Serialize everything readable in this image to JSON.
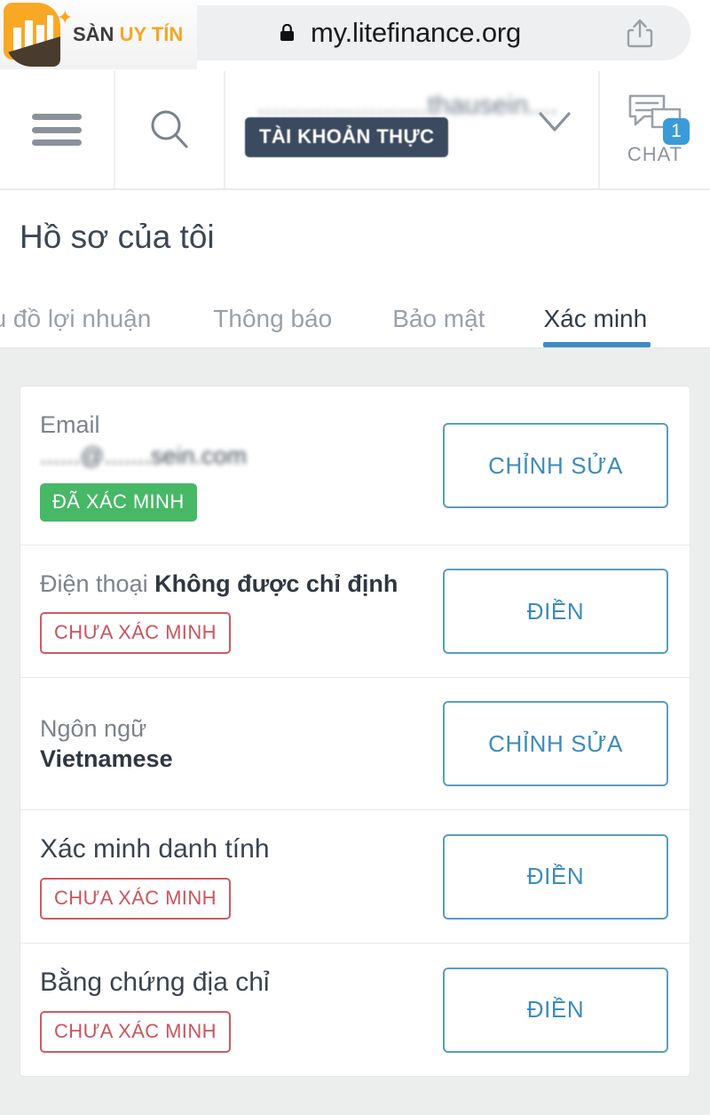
{
  "browser": {
    "url": "my.litefinance.org",
    "lock_icon": "lock-icon",
    "share_icon": "share-icon"
  },
  "watermark": {
    "text_primary": "SÀN",
    "text_accent": "UY TÍN"
  },
  "topnav": {
    "menu_icon": "hamburger-menu-icon",
    "search_icon": "search-icon",
    "account_name": ".......................thausein....",
    "account_badge": "TÀI KHOẢN THỰC",
    "dropdown_icon": "chevron-down-icon",
    "chat_label": "CHAT",
    "chat_count": "1",
    "chat_icon": "chat-bubbles-icon"
  },
  "page": {
    "title": "Hồ sơ của tôi"
  },
  "tabs": [
    {
      "label": "ểu đồ lợi nhuận",
      "active": false
    },
    {
      "label": "Thông báo",
      "active": false
    },
    {
      "label": "Bảo mật",
      "active": false
    },
    {
      "label": "Xác minh",
      "active": true
    }
  ],
  "rows": [
    {
      "label": "Email",
      "value": "......@.......sein.com",
      "badge": "ĐÃ XÁC MINH",
      "badge_state": "verified",
      "action": "CHỈNH SỬA"
    },
    {
      "label": "Điện thoại",
      "value": "Không được chỉ định",
      "badge": "CHƯA XÁC MINH",
      "badge_state": "unverified",
      "action": "ĐIỀN"
    },
    {
      "label": "Ngôn ngữ",
      "value": "Vietnamese",
      "badge": "",
      "badge_state": "none",
      "action": "CHỈNH SỬA"
    },
    {
      "label": "Xác minh danh tính",
      "value": "",
      "badge": "CHƯA XÁC MINH",
      "badge_state": "unverified",
      "action": "ĐIỀN"
    },
    {
      "label": "Bằng chứng địa chỉ",
      "value": "",
      "badge": "CHƯA XÁC MINH",
      "badge_state": "unverified",
      "action": "ĐIỀN"
    }
  ],
  "colors": {
    "accent_blue": "#3d8bbf",
    "verified_green": "#46b866",
    "unverified_red": "#c9555f",
    "badge_navy": "#3b4a5e",
    "logo_orange": "#f5a623",
    "page_bg": "#eceded"
  }
}
